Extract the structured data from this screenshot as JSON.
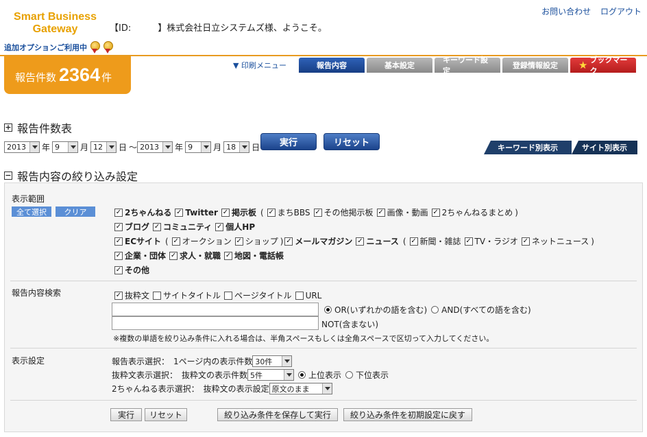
{
  "header": {
    "logo_line1": "Smart Business",
    "logo_line2": "Gateway",
    "welcome": "【ID:　　　】株式会社日立システムズ様、ようこそ。",
    "contact": "お問い合わせ",
    "logout": "ログアウト",
    "option_text": "追加オプションご利用中",
    "count_label": "報告件数",
    "count_value": "2364",
    "count_unit": "件",
    "print_menu": "▼ 印刷メニュー",
    "tabs": [
      "報告内容",
      "基本設定",
      "キーワード設定",
      "登録情報設定"
    ],
    "bookmark": "ブックマーク"
  },
  "summary": {
    "title": "報告件数表",
    "from": {
      "year": "2013",
      "month": "9",
      "day": "12"
    },
    "to": {
      "year": "2013",
      "month": "9",
      "day": "18"
    },
    "year_label": "年",
    "month_label": "月",
    "day_label": "日",
    "tilde": "～",
    "run": "実行",
    "reset": "リセット",
    "tab_keyword": "キーワード別表示",
    "tab_site": "サイト別表示"
  },
  "filter": {
    "title": "報告内容の絞り込み設定",
    "range_label": "表示範囲",
    "select_all": "全て選択",
    "clear": "クリア",
    "line1": {
      "a": "2ちゃんねる",
      "b": "Twitter",
      "c": "掲示板",
      "d": "まちBBS",
      "e": "その他掲示板",
      "f": "画像・動画",
      "g": "2ちゃんねるまとめ"
    },
    "line2": {
      "a": "ブログ",
      "b": "コミュニティ",
      "c": "個人HP"
    },
    "line3": {
      "a": "ECサイト",
      "b": "オークション",
      "c": "ショップ",
      "d": "メールマガジン",
      "e": "ニュース",
      "f": "新聞・雑誌",
      "g": "TV・ラジオ",
      "h": "ネットニュース"
    },
    "line4": {
      "a": "企業・団体",
      "b": "求人・就職",
      "c": "地図・電話帳"
    },
    "line5": {
      "a": "その他"
    },
    "search_label": "報告内容検索",
    "search_targets": {
      "a": "抜粋文",
      "b": "サイトタイトル",
      "c": "ページタイトル",
      "d": "URL"
    },
    "or_label": "OR(いずれかの語を含む)",
    "and_label": "AND(すべての語を含む)",
    "not_label": "NOT(含まない)",
    "note": "※複数の単語を絞り込み条件に入れる場合は、半角スペースもしくは全角スペースで区切って入力してください。",
    "display_label": "表示設定",
    "report_select_label": "報告表示選択：",
    "per_page_label": "1ページ内の表示件数",
    "per_page_value": "30件",
    "excerpt_select_label": "抜粋文表示選択：",
    "excerpt_count_label": "抜粋文の表示件数",
    "excerpt_count_value": "5件",
    "top_label": "上位表示",
    "bottom_label": "下位表示",
    "ch2_select_label": "2ちゃんねる表示選択：",
    "ch2_setting_label": "抜粋文の表示設定",
    "ch2_setting_value": "原文のまま",
    "run": "実行",
    "reset": "リセット",
    "save_run": "絞り込み条件を保存して実行",
    "restore": "絞り込み条件を初期設定に戻す"
  },
  "check_mark": "✓"
}
